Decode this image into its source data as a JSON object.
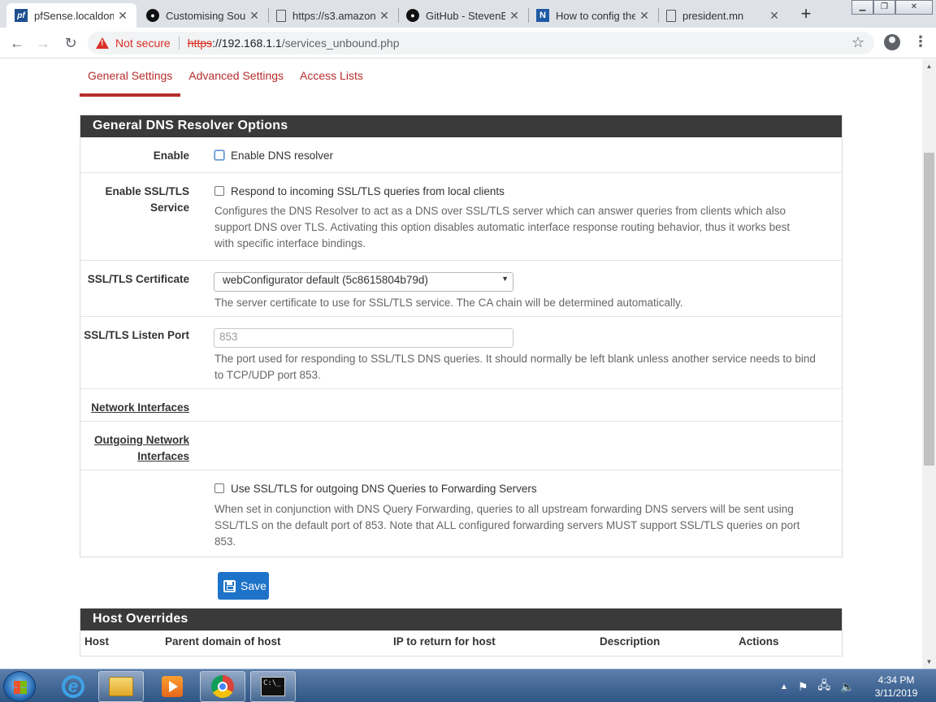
{
  "browser": {
    "tabs": [
      {
        "title": "pfSense.localdom",
        "favicon": "pfsense-icon",
        "active": true
      },
      {
        "title": "Customising Sour",
        "favicon": "github-icon",
        "active": false
      },
      {
        "title": "https://s3.amazon",
        "favicon": "document-icon",
        "active": false
      },
      {
        "title": "GitHub - StevenBl",
        "favicon": "github-icon",
        "active": false
      },
      {
        "title": "How to config the",
        "favicon": "n-site-icon",
        "active": false
      },
      {
        "title": "president.mn",
        "favicon": "document-icon",
        "active": false
      }
    ],
    "security_label": "Not secure",
    "url_scheme": "https",
    "url_host": "://192.168.1.1",
    "url_path": "/services_unbound.php"
  },
  "nav_tabs": [
    "General Settings",
    "Advanced Settings",
    "Access Lists"
  ],
  "general_panel": {
    "title": "General DNS Resolver Options",
    "enable": {
      "label": "Enable",
      "checkbox_label": "Enable DNS resolver",
      "checked": false
    },
    "ssl": {
      "label_line1": "Enable SSL/TLS",
      "label_line2": "Service",
      "checkbox_label": "Respond to incoming SSL/TLS queries from local clients",
      "help_line1": "Configures the DNS Resolver to act as a DNS over SSL/TLS server which can answer queries from clients which also",
      "help_line2": "support DNS over TLS. Activating this option disables automatic interface response routing behavior, thus it works best",
      "help_line3": "with specific interface bindings.",
      "checked": false
    },
    "cert": {
      "label": "SSL/TLS Certificate",
      "selected": "webConfigurator default (5c8615804b79d)",
      "help": "The server certificate to use for SSL/TLS service. The CA chain will be determined automatically."
    },
    "port": {
      "label": "SSL/TLS Listen Port",
      "placeholder": "853",
      "help_line1": "The port used for responding to SSL/TLS DNS queries. It should normally be left blank unless another service needs to bind",
      "help_line2": "to TCP/UDP port 853."
    },
    "network_interfaces": {
      "label": "Network Interfaces"
    },
    "outgoing": {
      "label_line1": "Outgoing Network",
      "label_line2": "Interfaces"
    },
    "forward_tls": {
      "checkbox_label": "Use SSL/TLS for outgoing DNS Queries to Forwarding Servers",
      "help_line1": "When set in conjunction with DNS Query Forwarding, queries to all upstream forwarding DNS servers will be sent using",
      "help_line2": "SSL/TLS on the default port of 853. Note that ALL configured forwarding servers MUST support SSL/TLS queries on port",
      "help_line3": "853.",
      "checked": false
    }
  },
  "save_label": "Save",
  "host_overrides": {
    "title": "Host Overrides",
    "columns": [
      "Host",
      "Parent domain of host",
      "IP to return for host",
      "Description",
      "Actions"
    ]
  },
  "taskbar": {
    "time": "4:34 PM",
    "date": "3/11/2019",
    "cmd_text": "C:\\_"
  },
  "colors": {
    "accent": "#b72d2d",
    "panel_header": "#3a3a3a",
    "button": "#1e73c8",
    "insecure": "#d93025"
  }
}
